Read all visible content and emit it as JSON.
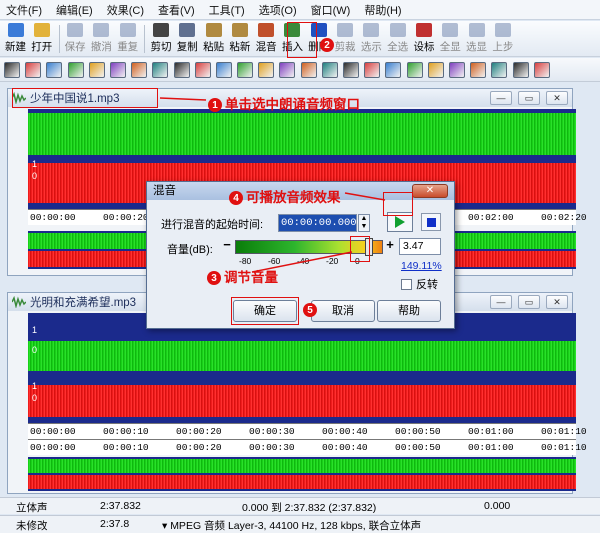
{
  "menu": [
    "文件(F)",
    "编辑(E)",
    "效果(C)",
    "查看(V)",
    "工具(T)",
    "选项(O)",
    "窗口(W)",
    "帮助(H)"
  ],
  "toolbar": [
    {
      "label": "新建",
      "icon": "new-file-icon",
      "color": "#3b7bd8",
      "disabled": false
    },
    {
      "label": "打开",
      "icon": "open-folder-icon",
      "color": "#e2b23a",
      "disabled": false
    },
    {
      "sep": true
    },
    {
      "label": "保存",
      "icon": "save-icon",
      "color": "#5870a0",
      "disabled": true
    },
    {
      "label": "撤消",
      "icon": "undo-icon",
      "color": "#5870a0",
      "disabled": true
    },
    {
      "label": "重复",
      "icon": "redo-icon",
      "color": "#5870a0",
      "disabled": true
    },
    {
      "sep": true
    },
    {
      "label": "剪切",
      "icon": "scissors-icon",
      "color": "#444444",
      "disabled": false
    },
    {
      "label": "复制",
      "icon": "copy-icon",
      "color": "#607090",
      "disabled": false
    },
    {
      "label": "粘贴",
      "icon": "paste-icon",
      "color": "#b08a40",
      "disabled": false
    },
    {
      "label": "粘新",
      "icon": "paste-new-icon",
      "color": "#b08a40",
      "disabled": false
    },
    {
      "label": "混音",
      "icon": "mix-paste-icon",
      "color": "#c0502c",
      "disabled": false
    },
    {
      "label": "插入",
      "icon": "insert-icon",
      "color": "#3a8a3a",
      "disabled": false
    },
    {
      "label": "删除",
      "icon": "delete-icon",
      "color": "#2050c0",
      "disabled": false
    },
    {
      "label": "剪裁",
      "icon": "trim-icon",
      "color": "#5870a0",
      "disabled": true
    },
    {
      "label": "选示",
      "icon": "select-view-icon",
      "color": "#5870a0",
      "disabled": true
    },
    {
      "label": "全选",
      "icon": "select-all-icon",
      "color": "#5870a0",
      "disabled": true
    },
    {
      "label": "设标",
      "icon": "set-marker-icon",
      "color": "#c03030",
      "disabled": false
    },
    {
      "label": "全显",
      "icon": "show-all-icon",
      "color": "#5870a0",
      "disabled": true
    },
    {
      "label": "选显",
      "icon": "show-selection-icon",
      "color": "#5870a0",
      "disabled": true
    },
    {
      "label": "上步",
      "icon": "previous-step-icon",
      "color": "#5870a0",
      "disabled": true
    }
  ],
  "toolbar2_icons": [
    "cursor-icon",
    "fx-1-icon",
    "fx-2-icon",
    "fx-3-icon",
    "fx-4-icon",
    "fx-5-icon",
    "fx-6-icon",
    "fx-7-icon",
    "fx-8-icon",
    "fx-9-icon",
    "fx-10-icon",
    "fx-11-icon",
    "fx-12-icon",
    "fx-13-icon",
    "fx-14-icon",
    "fx-15-icon",
    "fx-16-icon",
    "fx-17-icon",
    "fx-18-icon",
    "fx-19-icon",
    "fx-20-icon",
    "fx-21-icon",
    "fx-22-icon",
    "fx-23-icon",
    "fx-24-icon",
    "fx-25-icon"
  ],
  "window1": {
    "title": "少年中国说1.mp3",
    "ruler_main": [
      "00:00:00",
      "00:00:20",
      "00:00:40",
      "00:01:00",
      "00:01:20",
      "00:01:40",
      "00:02:00",
      "00:02:20"
    ],
    "ruler_overview": [
      "00:00:00",
      "00:00:20"
    ]
  },
  "window2": {
    "title": "光明和充满希望.mp3",
    "ruler_main": [
      "00:00:00",
      "00:00:10",
      "00:00:20",
      "00:00:30",
      "00:00:40",
      "00:00:50",
      "00:01:00",
      "00:01:10"
    ],
    "ruler_overview": [
      "00:00:00",
      "00:00:10",
      "00:00:20",
      "00:00:30",
      "00:00:40",
      "00:00:50",
      "00:01:00",
      "00:01:10"
    ]
  },
  "channel_labels": {
    "one": "1",
    "zero": "0"
  },
  "dialog": {
    "title": "混音",
    "close": "✕",
    "start_time_label": "进行混音的起始时间:",
    "start_time_value": "00:00:00.00000",
    "volume_label": "音量(dB):",
    "volume_ticks": [
      "-80",
      "-60",
      "-40",
      "-20",
      "0"
    ],
    "volume_level_db": 3.47,
    "volume_value": "3.47",
    "volume_percent": "149.11%",
    "invert_label": "反转",
    "ok": "确定",
    "cancel": "取消",
    "help": "帮助"
  },
  "annotations": [
    {
      "num": "1",
      "text": "单击选中朗诵音频窗口"
    },
    {
      "num": "2",
      "text": ""
    },
    {
      "num": "3",
      "text": "调节音量"
    },
    {
      "num": "4",
      "text": "可播放音频效果"
    },
    {
      "num": "5",
      "text": ""
    }
  ],
  "status": {
    "row1": {
      "mode": "立体声",
      "length": "2:37.832",
      "range": "0.000 到 2:37.832 (2:37.832)",
      "sel": "0.000"
    },
    "row2": {
      "modified": "未修改",
      "length": "2:37.8",
      "format": "▾ MPEG 音频 Layer-3, 44100 Hz, 128 kbps, 联合立体声"
    }
  },
  "colors": {
    "accent_red": "#e01010",
    "wave_bg": "#1b2a8c",
    "wave_green": "#18d018",
    "wave_red": "#ee1c1c"
  }
}
